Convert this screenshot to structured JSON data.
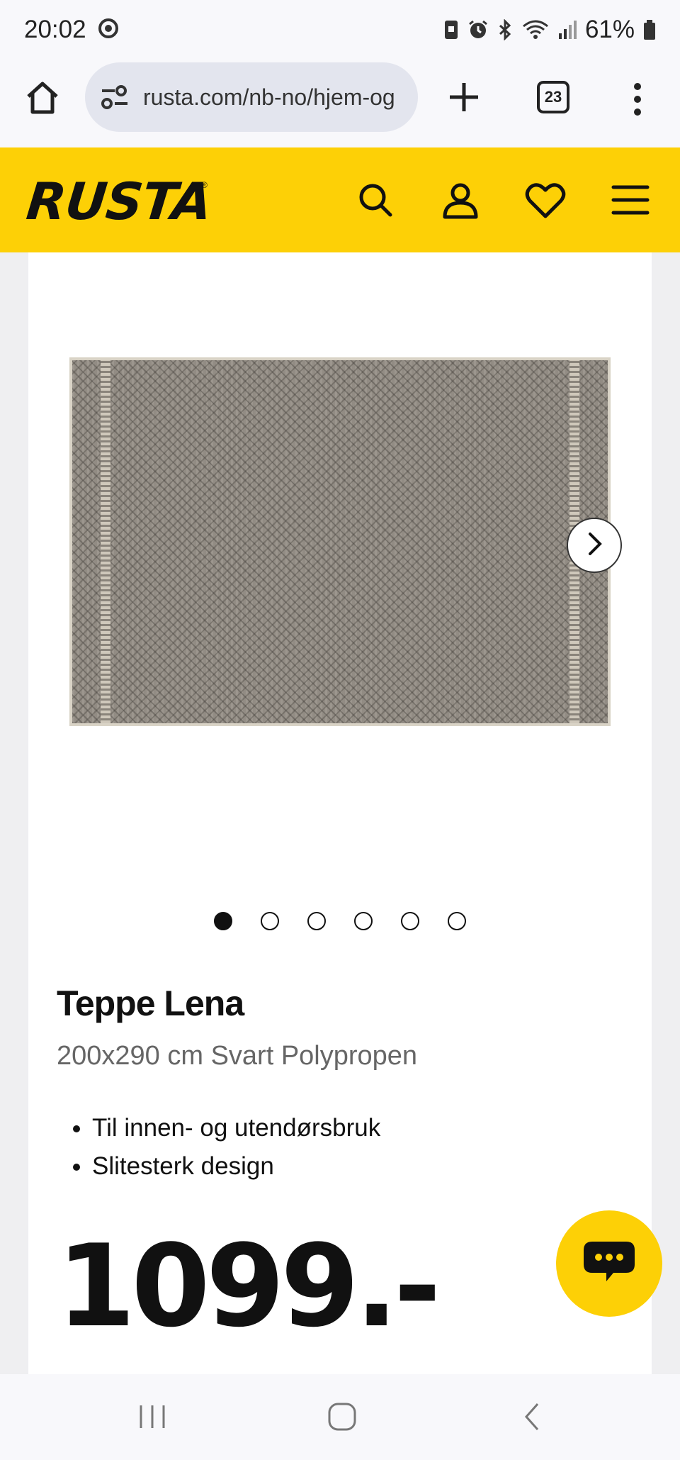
{
  "status_bar": {
    "time": "20:02",
    "battery": "61%"
  },
  "browser": {
    "url": "rusta.com/nb-no/hjem-og",
    "tab_count": "23"
  },
  "site": {
    "logo": "RUSTA",
    "logo_mark": "®",
    "brand_color": "#fdd006"
  },
  "product": {
    "title": "Teppe Lena",
    "subtitle": "200x290 cm Svart Polypropen",
    "features": [
      "Til innen- og utendørsbruk",
      "Slitesterk design"
    ],
    "price": "1099.-",
    "gallery": {
      "image_count": 6,
      "active_index": 0
    }
  },
  "icons": {
    "status": [
      "chrome-icon",
      "sim-icon",
      "alarm-icon",
      "bluetooth-icon",
      "wifi-icon",
      "signal-icon",
      "battery-icon"
    ],
    "browser": [
      "home-icon",
      "site-settings-icon",
      "plus-icon",
      "tabs-icon",
      "more-vert-icon"
    ],
    "header": [
      "search-icon",
      "user-icon",
      "heart-icon",
      "hamburger-icon"
    ],
    "gallery": [
      "chevron-right-icon"
    ],
    "chat": [
      "chat-bubble-icon"
    ],
    "nav": [
      "recents-icon",
      "home-nav-icon",
      "back-icon"
    ]
  }
}
